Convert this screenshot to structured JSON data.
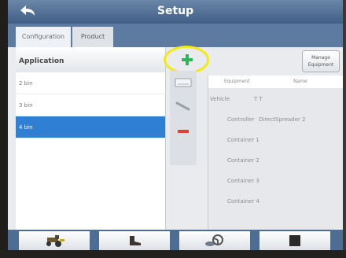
{
  "header": {
    "title": "Setup"
  },
  "tabs": [
    {
      "label": "Configuration",
      "active": true
    },
    {
      "label": "Product",
      "active": false
    }
  ],
  "applications": {
    "heading": "Application",
    "items": [
      {
        "label": "2 bin",
        "selected": false
      },
      {
        "label": "3 bin",
        "selected": false
      },
      {
        "label": "4 bin",
        "selected": true
      }
    ]
  },
  "toolbar": {
    "add_icon": "plus-icon",
    "manage_line1": "Manage",
    "manage_line2": "Equipment"
  },
  "equipment": {
    "col_equipment": "Equipment",
    "col_name": "Name",
    "vehicle_label": "Vehicle",
    "vehicle_name": "T T",
    "controller_label": "Controller",
    "controller_name": "DirectSpreader 2",
    "containers": [
      "Container 1",
      "Container 2",
      "Container 3",
      "Container 4"
    ]
  },
  "bottom_nav": [
    "tractor-icon",
    "boot-icon",
    "steering-wheel-icon",
    "stop-icon"
  ],
  "colors": {
    "titlebar": "#4a6a90",
    "selection": "#2f7fd4",
    "highlight": "#f3ea10",
    "add_green": "#2fb55a",
    "remove_red": "#e0403c"
  }
}
